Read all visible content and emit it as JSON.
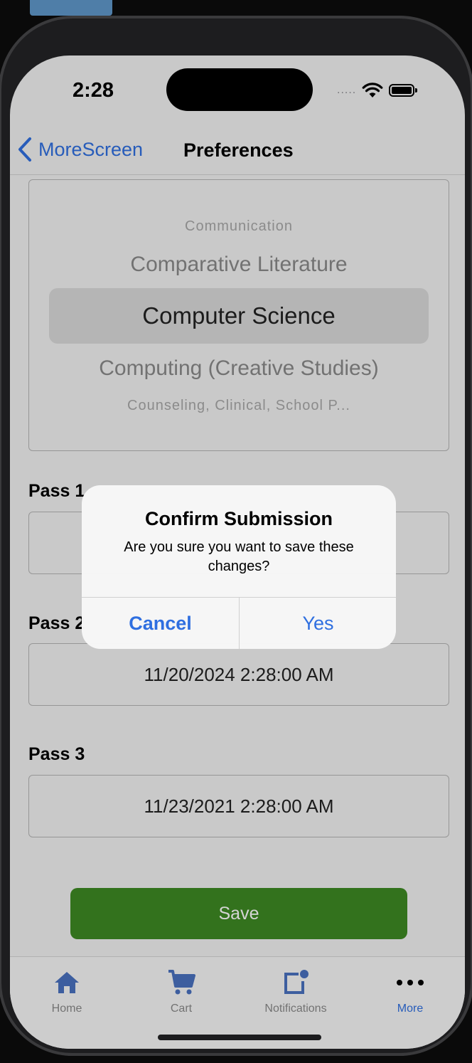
{
  "status_bar": {
    "time": "2:28",
    "signal": "....."
  },
  "nav": {
    "back_label": "MoreScreen",
    "title": "Preferences"
  },
  "picker": {
    "items": [
      "Communication",
      "Comparative Literature",
      "Computer Science",
      "Computing (Creative Studies)",
      "Counseling, Clinical, School P..."
    ],
    "selected": "Computer Science"
  },
  "passes": [
    {
      "label": "Pass 1",
      "value": ""
    },
    {
      "label": "Pass 2",
      "value": "11/20/2024 2:28:00 AM"
    },
    {
      "label": "Pass 3",
      "value": "11/23/2021 2:28:00 AM"
    }
  ],
  "save_label": "Save",
  "dialog": {
    "title": "Confirm Submission",
    "message": "Are you sure you want to save these changes?",
    "cancel": "Cancel",
    "confirm": "Yes"
  },
  "tabs": [
    {
      "label": "Home",
      "icon": "home-icon"
    },
    {
      "label": "Cart",
      "icon": "cart-icon"
    },
    {
      "label": "Notifications",
      "icon": "notifications-icon"
    },
    {
      "label": "More",
      "icon": "more-icon"
    }
  ],
  "active_tab": "More",
  "colors": {
    "accent": "#2f6fe0",
    "save": "#3e8a23"
  }
}
